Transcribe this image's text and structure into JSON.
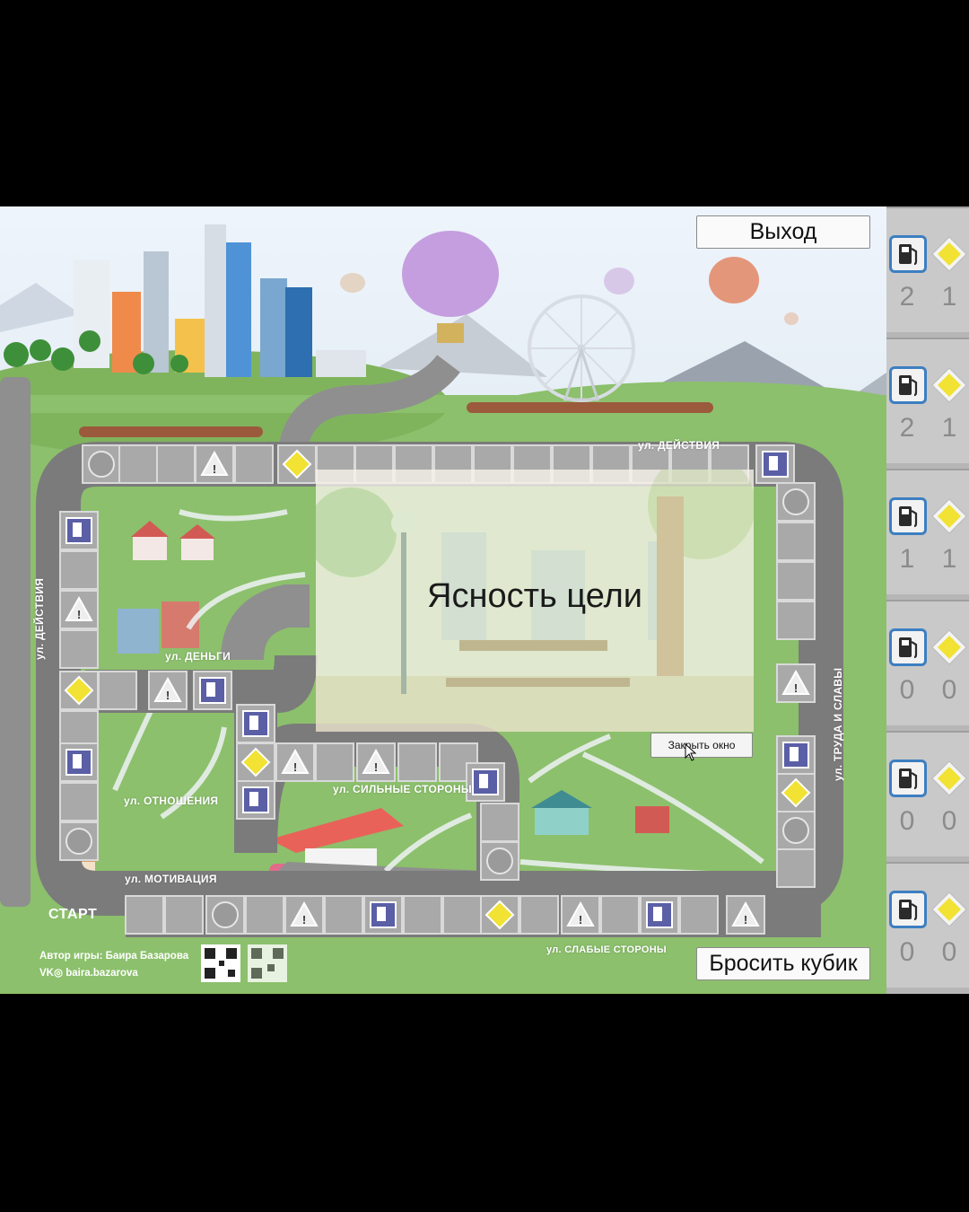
{
  "buttons": {
    "exit": "Выход",
    "roll_dice": "Бросить кубик"
  },
  "modal": {
    "title": "Ясность цели",
    "close": "Закрыть окно"
  },
  "streets": {
    "action_top": "ул. ДЕЙСТВИЯ",
    "action_left": "ул. ДЕЙСТВИЯ",
    "money": "ул. ДЕНЬГИ",
    "relations": "ул. ОТНОШЕНИЯ",
    "strengths": "ул. СИЛЬНЫЕ СТОРОНЫ",
    "motivation": "ул. МОТИВАЦИЯ",
    "weaknesses": "ул. СЛАБЫЕ СТОРОНЫ",
    "labor": "ул. ТРУДА И СЛАВЫ"
  },
  "start": "СТАРТ",
  "author": {
    "line1": "Автор игры: Баира Базарова",
    "line2": "baira.bazarova"
  },
  "players": [
    {
      "fuel": "2",
      "signs": "1"
    },
    {
      "fuel": "2",
      "signs": "1"
    },
    {
      "fuel": "1",
      "signs": "1"
    },
    {
      "fuel": "0",
      "signs": "0"
    },
    {
      "fuel": "0",
      "signs": "0"
    },
    {
      "fuel": "0",
      "signs": "0"
    }
  ],
  "colors": {
    "grass": "#8cc06c",
    "road": "#8f8f8f",
    "cell": "#a9a9a9",
    "fuel_cell": "#5b5fa6",
    "sign_yellow": "#f1e233",
    "panel": "#c9c9c9",
    "panel_border": "#3d7fc1"
  }
}
